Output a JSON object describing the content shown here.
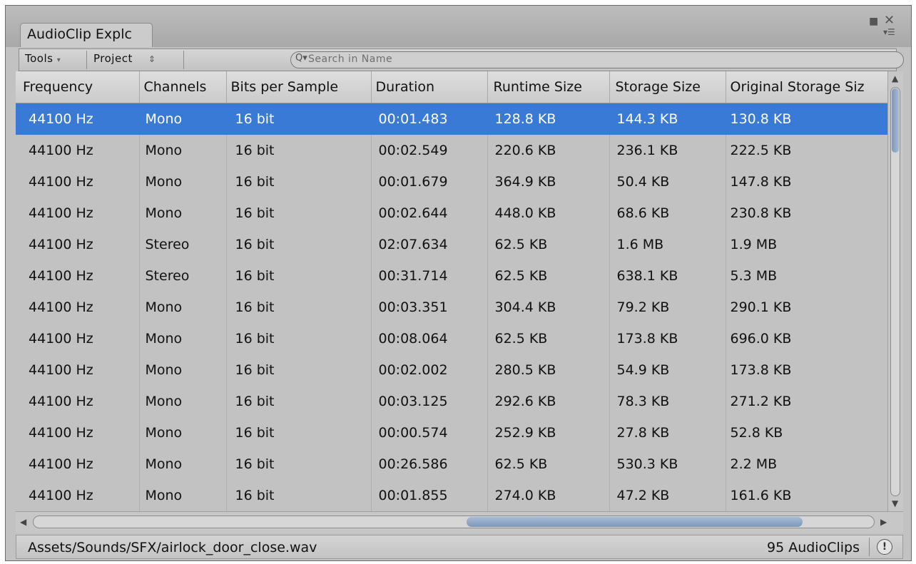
{
  "window": {
    "tab_title": "AudioClip Explc",
    "menu_icon": "menu-icon",
    "maximize_icon": "maximize-icon",
    "close_icon": "close-icon"
  },
  "toolbar": {
    "tools_label": "Tools",
    "tools_arrow": "▾",
    "project_label": "Project",
    "project_arrow": "⇕",
    "search_placeholder": "Search in Name",
    "search_icon": "Q▾"
  },
  "table": {
    "columns": [
      "Frequency",
      "Channels",
      "Bits per Sample",
      "Duration",
      "Runtime Size",
      "Storage Size",
      "Original Storage Siz"
    ],
    "selected_row": 0,
    "rows": [
      [
        "44100 Hz",
        "Mono",
        "16 bit",
        "00:01.483",
        "128.8 KB",
        "144.3 KB",
        "130.8 KB"
      ],
      [
        "44100 Hz",
        "Mono",
        "16 bit",
        "00:02.549",
        "220.6 KB",
        "236.1 KB",
        "222.5 KB"
      ],
      [
        "44100 Hz",
        "Mono",
        "16 bit",
        "00:01.679",
        "364.9 KB",
        "50.4 KB",
        "147.8 KB"
      ],
      [
        "44100 Hz",
        "Mono",
        "16 bit",
        "00:02.644",
        "448.0 KB",
        "68.6 KB",
        "230.8 KB"
      ],
      [
        "44100 Hz",
        "Stereo",
        "16 bit",
        "02:07.634",
        "62.5 KB",
        "1.6 MB",
        "1.9 MB"
      ],
      [
        "44100 Hz",
        "Stereo",
        "16 bit",
        "00:31.714",
        "62.5 KB",
        "638.1 KB",
        "5.3 MB"
      ],
      [
        "44100 Hz",
        "Mono",
        "16 bit",
        "00:03.351",
        "304.4 KB",
        "79.2 KB",
        "290.1 KB"
      ],
      [
        "44100 Hz",
        "Mono",
        "16 bit",
        "00:08.064",
        "62.5 KB",
        "173.8 KB",
        "696.0 KB"
      ],
      [
        "44100 Hz",
        "Mono",
        "16 bit",
        "00:02.002",
        "280.5 KB",
        "54.9 KB",
        "173.8 KB"
      ],
      [
        "44100 Hz",
        "Mono",
        "16 bit",
        "00:03.125",
        "292.6 KB",
        "78.3 KB",
        "271.2 KB"
      ],
      [
        "44100 Hz",
        "Mono",
        "16 bit",
        "00:00.574",
        "252.9 KB",
        "27.8 KB",
        "52.8 KB"
      ],
      [
        "44100 Hz",
        "Mono",
        "16 bit",
        "00:26.586",
        "62.5 KB",
        "530.3 KB",
        "2.2 MB"
      ],
      [
        "44100 Hz",
        "Mono",
        "16 bit",
        "00:01.855",
        "274.0 KB",
        "47.2 KB",
        "161.6 KB"
      ]
    ]
  },
  "scroll": {
    "vertical_thumb_fraction": 0.16,
    "vertical_position": 0.0,
    "horizontal_thumb_fraction": 0.4,
    "horizontal_position": 1.0
  },
  "status": {
    "path": "Assets/Sounds/SFX/airlock_door_close.wav",
    "count": "95 AudioClips",
    "warning_icon": "warning-icon"
  },
  "colors": {
    "selection": "#3a7ad7",
    "scroll_thumb": "#8fa6c6"
  }
}
